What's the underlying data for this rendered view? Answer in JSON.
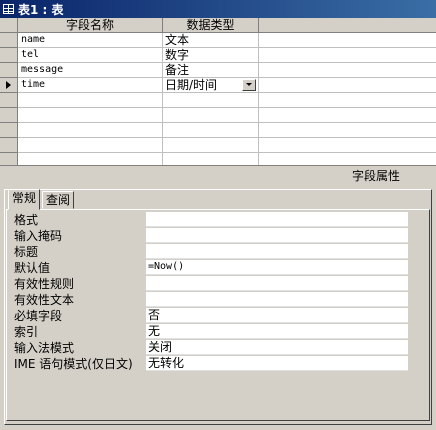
{
  "window": {
    "title": "表1 : 表"
  },
  "table": {
    "headers": {
      "field_name": "字段名称",
      "data_type": "数据类型"
    },
    "rows": [
      {
        "name": "name",
        "type": "文本"
      },
      {
        "name": "tel",
        "type": "数字"
      },
      {
        "name": "message",
        "type": "备注"
      },
      {
        "name": "time",
        "type": "日期/时间"
      }
    ]
  },
  "properties": {
    "title": "字段属性",
    "tabs": [
      "常规",
      "查阅"
    ],
    "items": [
      {
        "label": "格式",
        "value": ""
      },
      {
        "label": "输入掩码",
        "value": ""
      },
      {
        "label": "标题",
        "value": ""
      },
      {
        "label": "默认值",
        "value": "=Now()"
      },
      {
        "label": "有效性规则",
        "value": ""
      },
      {
        "label": "有效性文本",
        "value": ""
      },
      {
        "label": "必填字段",
        "value": "否"
      },
      {
        "label": "索引",
        "value": "无"
      },
      {
        "label": "输入法模式",
        "value": "关闭"
      },
      {
        "label": "IME 语句模式(仅日文)",
        "value": "无转化"
      }
    ]
  }
}
